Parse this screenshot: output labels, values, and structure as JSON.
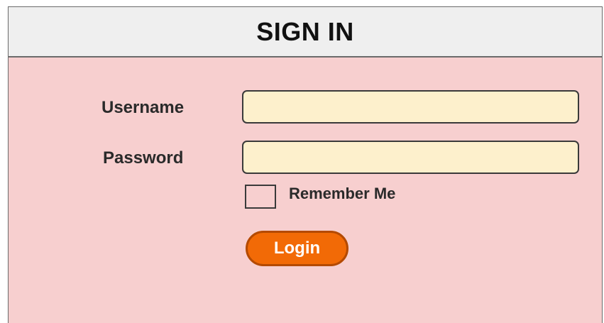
{
  "header": {
    "title": "SIGN IN"
  },
  "form": {
    "username_label": "Username",
    "username_value": "",
    "password_label": "Password",
    "password_value": "",
    "remember_label": "Remember Me",
    "remember_checked": false,
    "login_label": "Login"
  },
  "colors": {
    "form_background": "#f7cfcf",
    "header_background": "#efefef",
    "input_background": "#fdf0cc",
    "button_background": "#f26a06",
    "button_border": "#b44a00"
  }
}
